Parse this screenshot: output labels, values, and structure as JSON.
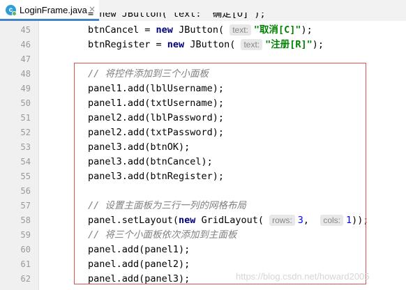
{
  "tab": {
    "title": "LoginFrame.java",
    "icon": "java-class-icon",
    "icon_letter": "c",
    "close_glyph": "×"
  },
  "partial_line": "= new JButton( text: \"确定[O]\");",
  "lines": [
    {
      "num": "45",
      "parts": [
        {
          "t": "btnCancel = "
        },
        {
          "t": "new",
          "c": "kw"
        },
        {
          "t": " JButton( "
        },
        {
          "t": "text:",
          "c": "hint"
        },
        {
          "t": "\"取消[C]\"",
          "c": "str"
        },
        {
          "t": ");"
        }
      ]
    },
    {
      "num": "46",
      "parts": [
        {
          "t": "btnRegister = "
        },
        {
          "t": "new",
          "c": "kw"
        },
        {
          "t": " JButton( "
        },
        {
          "t": "text:",
          "c": "hint"
        },
        {
          "t": "\"注册[R]\"",
          "c": "str"
        },
        {
          "t": ");"
        }
      ]
    },
    {
      "num": "47",
      "parts": []
    },
    {
      "num": "48",
      "parts": [
        {
          "t": "// 将控件添加到三个小面板",
          "c": "cm"
        }
      ]
    },
    {
      "num": "49",
      "parts": [
        {
          "t": "panel1.add(lblUsername);"
        }
      ]
    },
    {
      "num": "50",
      "parts": [
        {
          "t": "panel1.add(txtUsername);"
        }
      ]
    },
    {
      "num": "51",
      "parts": [
        {
          "t": "panel2.add(lblPassword);"
        }
      ]
    },
    {
      "num": "52",
      "parts": [
        {
          "t": "panel2.add(txtPassword);"
        }
      ]
    },
    {
      "num": "53",
      "parts": [
        {
          "t": "panel3.add(btnOK);"
        }
      ]
    },
    {
      "num": "54",
      "parts": [
        {
          "t": "panel3.add(btnCancel);"
        }
      ]
    },
    {
      "num": "55",
      "parts": [
        {
          "t": "panel3.add(btnRegister);"
        }
      ]
    },
    {
      "num": "56",
      "parts": []
    },
    {
      "num": "57",
      "parts": [
        {
          "t": "// 设置主面板为三行一列的网格布局",
          "c": "cm"
        }
      ]
    },
    {
      "num": "58",
      "parts": [
        {
          "t": "panel.setLayout("
        },
        {
          "t": "new",
          "c": "kw"
        },
        {
          "t": " GridLayout( "
        },
        {
          "t": "rows:",
          "c": "hint"
        },
        {
          "t": "3",
          "c": "num"
        },
        {
          "t": ",  "
        },
        {
          "t": "cols:",
          "c": "hint"
        },
        {
          "t": "1",
          "c": "num"
        },
        {
          "t": "));"
        }
      ]
    },
    {
      "num": "59",
      "parts": [
        {
          "t": "// 将三个小面板依次添加到主面板",
          "c": "cm"
        }
      ]
    },
    {
      "num": "60",
      "parts": [
        {
          "t": "panel.add(panel1);"
        }
      ]
    },
    {
      "num": "61",
      "parts": [
        {
          "t": "panel.add(panel2);"
        }
      ]
    },
    {
      "num": "62",
      "parts": [
        {
          "t": "panel.add(panel3);"
        }
      ]
    }
  ],
  "watermark": "https://blog.csdn.net/howard2005",
  "colors": {
    "keyword": "#000080",
    "string": "#008000",
    "number": "#0000ff",
    "comment": "#808080",
    "highlight_border": "#d9534f",
    "tab_underline": "#4083c9"
  }
}
